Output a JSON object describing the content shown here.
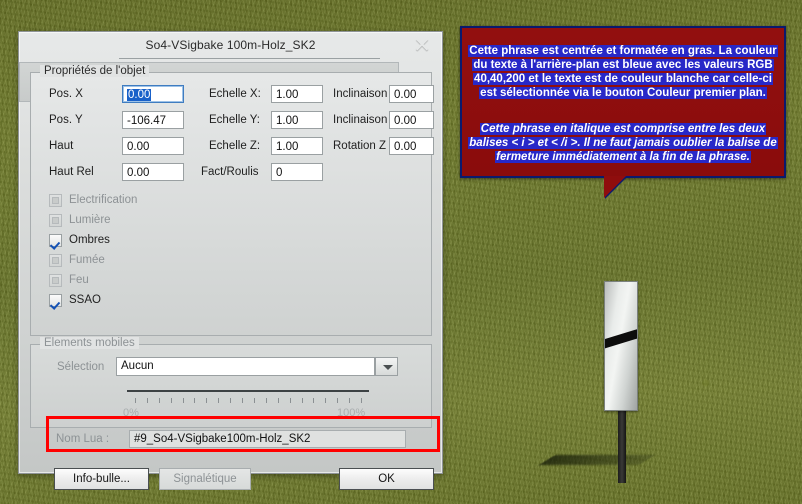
{
  "background": {
    "scene": "grass-terrain",
    "object": "railway-signpost",
    "grass_color": "#6f7a2a",
    "sign_board_color": "#e9ecea",
    "sign_stripe_color": "#0d0d0d"
  },
  "dialog": {
    "title": "So4-VSigbake 100m-Holz_SK2",
    "close_icon": "close-icon",
    "groups": {
      "properties": {
        "legend": "Propriétés de l'objet",
        "fields": [
          {
            "label": "Pos. X",
            "value": "0.00",
            "focused": true
          },
          {
            "label": "Pos. Y",
            "value": "-106.47",
            "focused": false
          },
          {
            "label": "Haut",
            "value": "0.00",
            "focused": false
          },
          {
            "label": "Haut Rel",
            "value": "0.00",
            "focused": false
          }
        ],
        "scale_fields": [
          {
            "label": "Echelle X:",
            "value": "1.00"
          },
          {
            "label": "Echelle Y:",
            "value": "1.00"
          },
          {
            "label": "Echelle Z:",
            "value": "1.00"
          },
          {
            "label": "Fact/Roulis",
            "value": "0"
          }
        ],
        "rotation_fields": [
          {
            "label": "Inclinaison",
            "value": "0.00"
          },
          {
            "label": "Inclinaison",
            "value": "0.00"
          },
          {
            "label": "Rotation Z",
            "value": "0.00"
          }
        ],
        "checkboxes": [
          {
            "label": "Electrification",
            "checked": false,
            "enabled": false
          },
          {
            "label": "Lumière",
            "checked": false,
            "enabled": false
          },
          {
            "label": "Ombres",
            "checked": true,
            "enabled": true
          },
          {
            "label": "Fumée",
            "checked": false,
            "enabled": false
          },
          {
            "label": "Feu",
            "checked": false,
            "enabled": false
          },
          {
            "label": "SSAO",
            "checked": true,
            "enabled": true
          }
        ]
      },
      "mobile_elements": {
        "legend": "Elements mobiles",
        "selection_label": "Sélection",
        "selection_value": "Aucun",
        "dropdown_icon": "chevron-down-icon",
        "slider_min_label": "0%",
        "slider_max_label": "100%",
        "tick_count": 20
      },
      "lua": {
        "label": "Nom Lua :",
        "value": "#9_So4-VSigbake100m-Holz_SK2",
        "highlight_color": "#ff0000"
      }
    },
    "buttons": {
      "info": {
        "label": "Info-bulle...",
        "enabled": true
      },
      "signage": {
        "label": "Signalétique",
        "enabled": false
      },
      "ok": {
        "label": "OK",
        "enabled": true
      }
    }
  },
  "bubble": {
    "background_color": "#8f0d0d",
    "border_color": "#0a1a6e",
    "selection_color": "#2828c8",
    "text_color": "#ffffff",
    "paragraph1": "Cette phrase est centrée et formatée en gras. La couleur du texte à l'arrière-plan est bleue avec les valeurs RGB 40,40,200 et le texte est de couleur blanche car celle-ci est sélectionnée via le bouton Couleur premier plan.",
    "paragraph2": "Cette phrase en italique est comprise entre les deux balises < i > et < /i >. Il ne faut jamais oublier la balise de fermeture immédiatement à la fin de la phrase."
  }
}
